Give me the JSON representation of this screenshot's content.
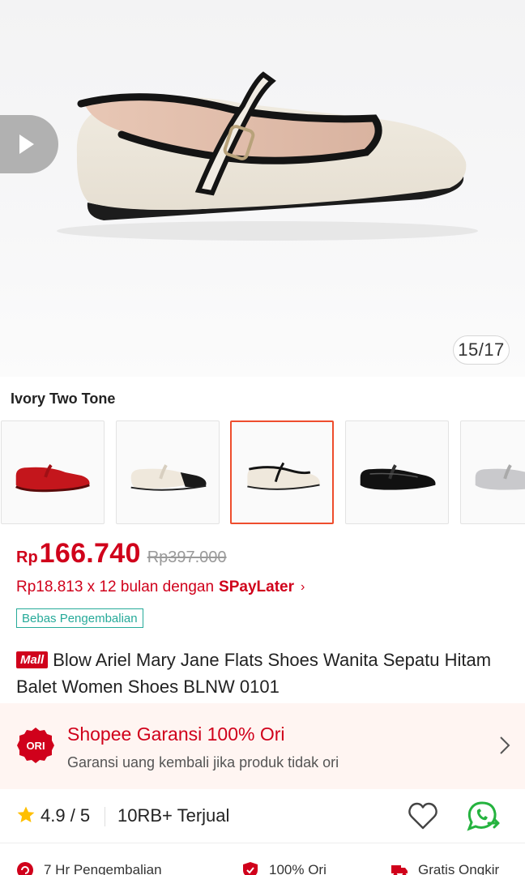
{
  "gallery": {
    "counter": "15/17",
    "play_icon": "play-icon"
  },
  "variant": {
    "selected_name": "Ivory Two Tone",
    "options": [
      {
        "color": "red"
      },
      {
        "color": "ivory-black-toe"
      },
      {
        "color": "ivory-two-tone"
      },
      {
        "color": "black"
      },
      {
        "color": "silver"
      }
    ]
  },
  "price": {
    "currency": "Rp",
    "current": "166.740",
    "original": "Rp397.000"
  },
  "installment": {
    "text": "Rp18.813 x 12 bulan dengan",
    "brand": "SPayLater",
    "chevron": "›"
  },
  "badges": {
    "return": "Bebas Pengembalian",
    "mall": "Mall"
  },
  "product": {
    "title": "Blow Ariel Mary Jane Flats Shoes Wanita Sepatu Hitam Balet Women Shoes BLNW 0101"
  },
  "guarantee": {
    "badge": "ORI",
    "title": "Shopee Garansi 100% Ori",
    "subtitle": "Garansi uang kembali jika produk tidak ori"
  },
  "stats": {
    "rating": "4.9 / 5",
    "sold": "10RB+ Terjual"
  },
  "perks": [
    {
      "label": "7 Hr Pengembalian"
    },
    {
      "label": "100% Ori"
    },
    {
      "label": "Gratis Ongkir"
    }
  ],
  "colors": {
    "accent": "#ee4d2d",
    "price_red": "#d0011b",
    "teal": "#26aa99",
    "whatsapp_green": "#25b33f"
  }
}
